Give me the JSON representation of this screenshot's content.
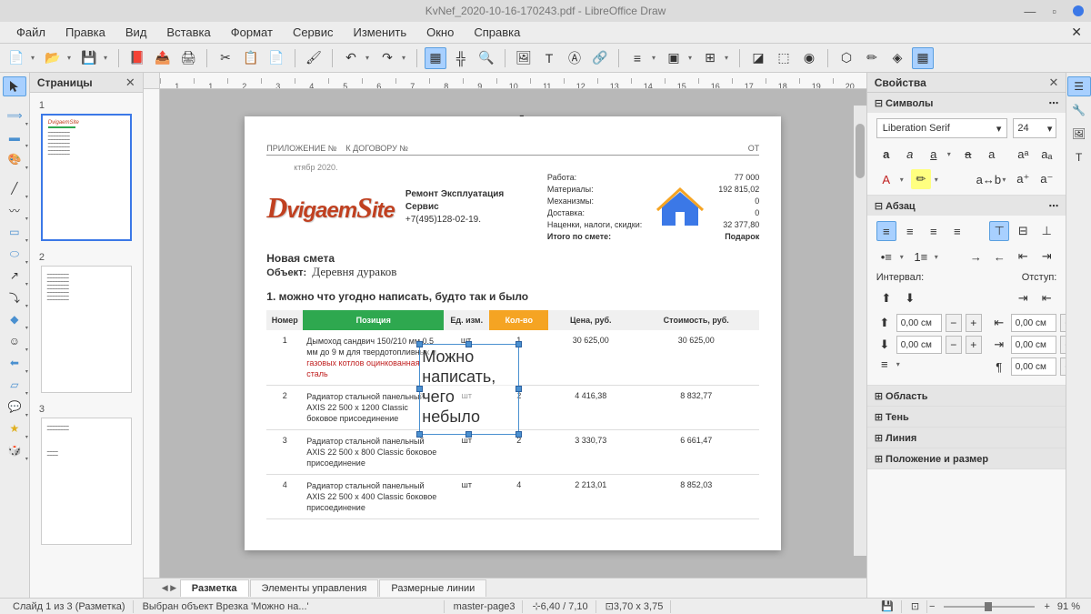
{
  "window": {
    "title": "KvNef_2020-10-16-170243.pdf - LibreOffice Draw"
  },
  "menu": [
    "Файл",
    "Правка",
    "Вид",
    "Вставка",
    "Формат",
    "Сервис",
    "Изменить",
    "Окно",
    "Справка"
  ],
  "panels": {
    "pages": "Страницы",
    "properties": "Свойства",
    "symbols": "Символы",
    "paragraph": "Абзац",
    "spacing_lbl": "Интервал:",
    "indent_lbl": "Отступ:",
    "area": "Область",
    "shadow": "Тень",
    "line": "Линия",
    "position": "Положение и размер"
  },
  "font": {
    "name": "Liberation Serif",
    "size": "24"
  },
  "spacing_val": "0,00 см",
  "doc_tabs": [
    "Разметка",
    "Элементы управления",
    "Размерные линии"
  ],
  "status": {
    "slide": "Слайд 1 из 3 (Разметка)",
    "selection": "Выбран объект Врезка 'Можно на...'",
    "master": "master-page3",
    "pos": "6,40 / 7,10",
    "size": "3,70 x 3,75",
    "zoom": "91 %"
  },
  "document": {
    "header": {
      "app_label": "ПРИЛОЖЕНИЕ №",
      "contract": "К ДОГОВОРУ №",
      "from": "ОТ"
    },
    "date": "ктябр 2020.",
    "logo_text": "DvigaemSite",
    "company_line": "Ремонт Эксплуатация Сервис",
    "phone": "+7(495)128-02-19.",
    "totals": [
      {
        "label": "Работа:",
        "value": "77 000"
      },
      {
        "label": "Материалы:",
        "value": "192 815,02"
      },
      {
        "label": "Механизмы:",
        "value": "0"
      },
      {
        "label": "Доставка:",
        "value": "0"
      },
      {
        "label": "Наценки, налоги, скидки:",
        "value": "32 377,80"
      },
      {
        "label": "Итого по смете:",
        "value": "Подарок"
      }
    ],
    "estimate_title": "Новая смета",
    "object_label": "Объект:",
    "object_value": "Деревня дураков",
    "section1": "1. можно что угодно написать, будто так и было",
    "table_headers": [
      "Номер",
      "Позиция",
      "Ед. изм.",
      "Кол-во",
      "Цена, руб.",
      "Стоимость, руб."
    ],
    "rows": [
      {
        "n": "1",
        "pos_main": "Дымоход сандвич 150/210 мм 0,5 мм до 9 м для твердотопливных и ",
        "pos_red": "газовых котлов оцинкованная сталь",
        "unit": "шт.",
        "qty": "1",
        "price": "30 625,00",
        "cost": "30 625,00"
      },
      {
        "n": "2",
        "pos_main": "Радиатор стальной панельный AXIS 22 500 x 1200 Classic боковое присоединение",
        "pos_red": "",
        "unit": "шт",
        "qty": "2",
        "price": "4 416,38",
        "cost": "8 832,77"
      },
      {
        "n": "3",
        "pos_main": "Радиатор стальной панельный AXIS 22 500 x 800 Classic боковое присоединение",
        "pos_red": "",
        "unit": "шт",
        "qty": "2",
        "price": "3 330,73",
        "cost": "6 661,47"
      },
      {
        "n": "4",
        "pos_main": "Радиатор стальной панельный AXIS 22 500 x 400 Classic боковое присоединение",
        "pos_red": "",
        "unit": "шт",
        "qty": "4",
        "price": "2 213,01",
        "cost": "8 852,03"
      }
    ],
    "frame_text": "Можно написать, чего небыло"
  }
}
